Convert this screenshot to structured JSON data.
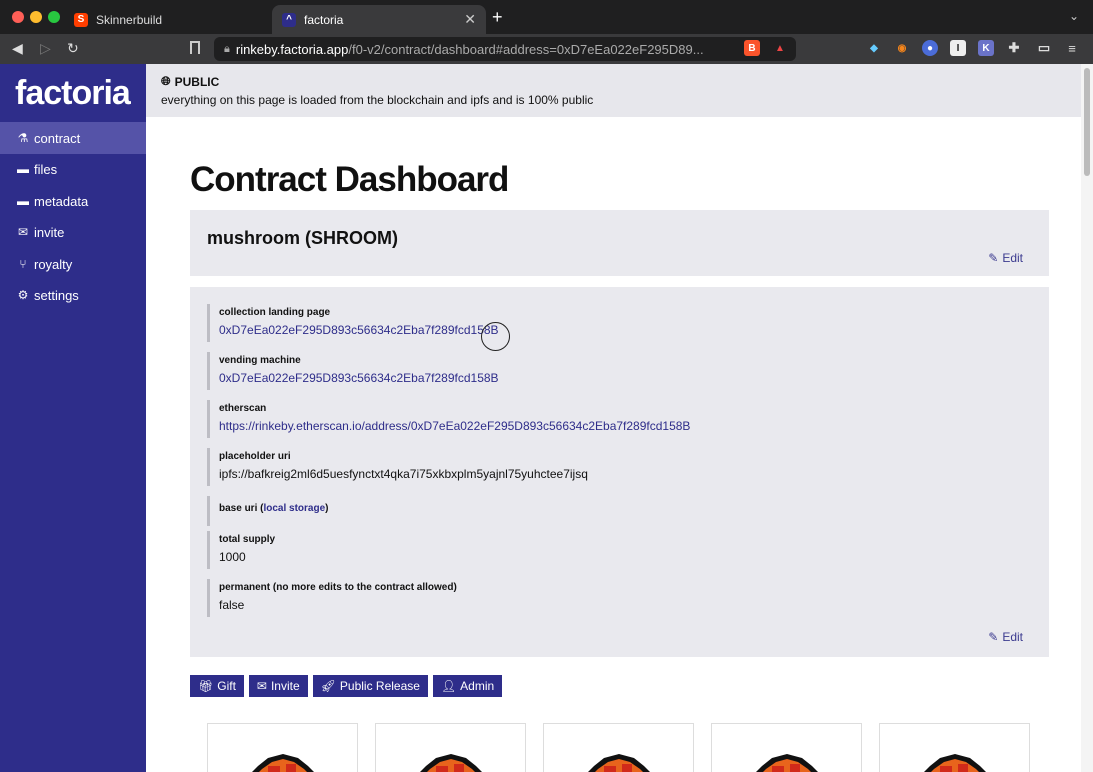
{
  "browser": {
    "tabs": [
      {
        "label": "Skinnerbuild",
        "active": false
      },
      {
        "label": "factoria",
        "active": true
      }
    ],
    "url_host": "rinkeby.factoria.app",
    "url_path": "/f0-v2/contract/dashboard#address=0xD7eEa022eF295D89..."
  },
  "sidebar": {
    "logo": "factoria",
    "items": [
      {
        "label": "contract",
        "icon": "flask-icon",
        "active": true
      },
      {
        "label": "files",
        "icon": "folder-icon",
        "active": false
      },
      {
        "label": "metadata",
        "icon": "folder-icon",
        "active": false
      },
      {
        "label": "invite",
        "icon": "envelope-open-icon",
        "active": false
      },
      {
        "label": "royalty",
        "icon": "branch-icon",
        "active": false
      },
      {
        "label": "settings",
        "icon": "gear-icon",
        "active": false
      }
    ]
  },
  "notice": {
    "title": "PUBLIC",
    "desc": "everything on this page is loaded from the blockchain and ipfs and is 100% public"
  },
  "page_title": "Contract Dashboard",
  "contract": {
    "name": "mushroom (SHROOM)",
    "edit_label": "Edit"
  },
  "fields": [
    {
      "label": "collection landing page",
      "value": "0xD7eEa022eF295D893c56634c2Eba7f289fcd158B",
      "link": true
    },
    {
      "label": "vending machine",
      "value": "0xD7eEa022eF295D893c56634c2Eba7f289fcd158B",
      "link": true
    },
    {
      "label": "etherscan",
      "value": "https://rinkeby.etherscan.io/address/0xD7eEa022eF295D893c56634c2Eba7f289fcd158B",
      "link": true
    },
    {
      "label": "placeholder uri",
      "value": "ipfs://bafkreig2ml6d5uesfynctxt4qka7i75xkbxplm5yajnl75yuhctee7ijsq",
      "link": false
    },
    {
      "label_prefix": "base uri (",
      "label_link": "local storage",
      "label_suffix": ")"
    },
    {
      "label": "total supply",
      "value": "1000",
      "link": false
    },
    {
      "label": "permanent (no more edits to the contract allowed)",
      "value": "false",
      "link": false
    }
  ],
  "actions": {
    "gift": "Gift",
    "invite": "Invite",
    "release": "Public Release",
    "admin": "Admin"
  },
  "colors": {
    "brand": "#2e2d8a",
    "active_nav": "#5553a8",
    "card_bg": "#e9e9ee"
  }
}
